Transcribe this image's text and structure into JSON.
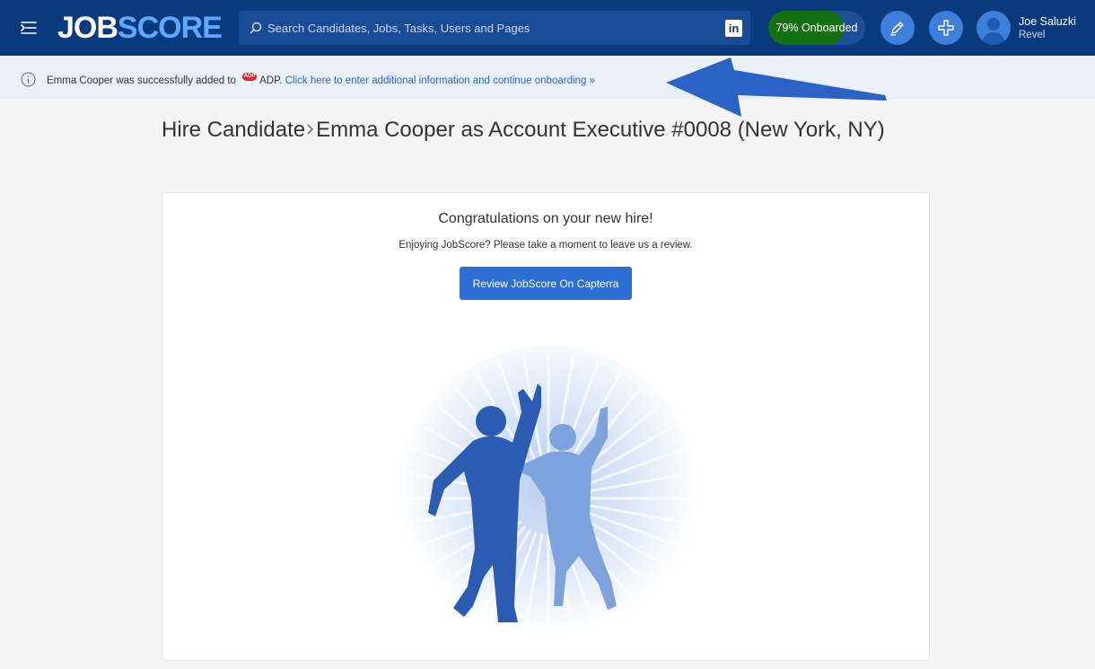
{
  "topbar": {
    "logo_job": "JOB",
    "logo_score": "SCORE",
    "search_placeholder": "Search Candidates, Jobs, Tasks, Users and Pages",
    "linkedin_label": "in",
    "onboarding": {
      "label": "79% Onboarded",
      "percent": 79,
      "fill_color": "#157012"
    },
    "user": {
      "name": "Joe Saluzki",
      "org": "Revel"
    },
    "icons": [
      "menu-icon",
      "search-icon",
      "linkedin-icon",
      "pencil-icon",
      "plus-icon",
      "user-avatar-icon"
    ]
  },
  "notice": {
    "text_before": "Emma Cooper was successfully added to",
    "adp_logo": "ADP",
    "text_after": "ADP.",
    "link": "Click here to enter additional information and continue onboarding »"
  },
  "page": {
    "title_prefix": "Hire Candidate",
    "title_main": "Emma Cooper as Account Executive #0008 (New York, NY)"
  },
  "card": {
    "heading": "Congratulations on your new hire!",
    "subtext": "Enjoying JobScore? Please take a moment to leave us a review.",
    "button_label": "Review JobScore On Capterra"
  },
  "colors": {
    "topbar": "#0a3a7e",
    "accent": "#2d6ed3",
    "link": "#2a63c4",
    "notice_bg": "#e9f0f8"
  }
}
